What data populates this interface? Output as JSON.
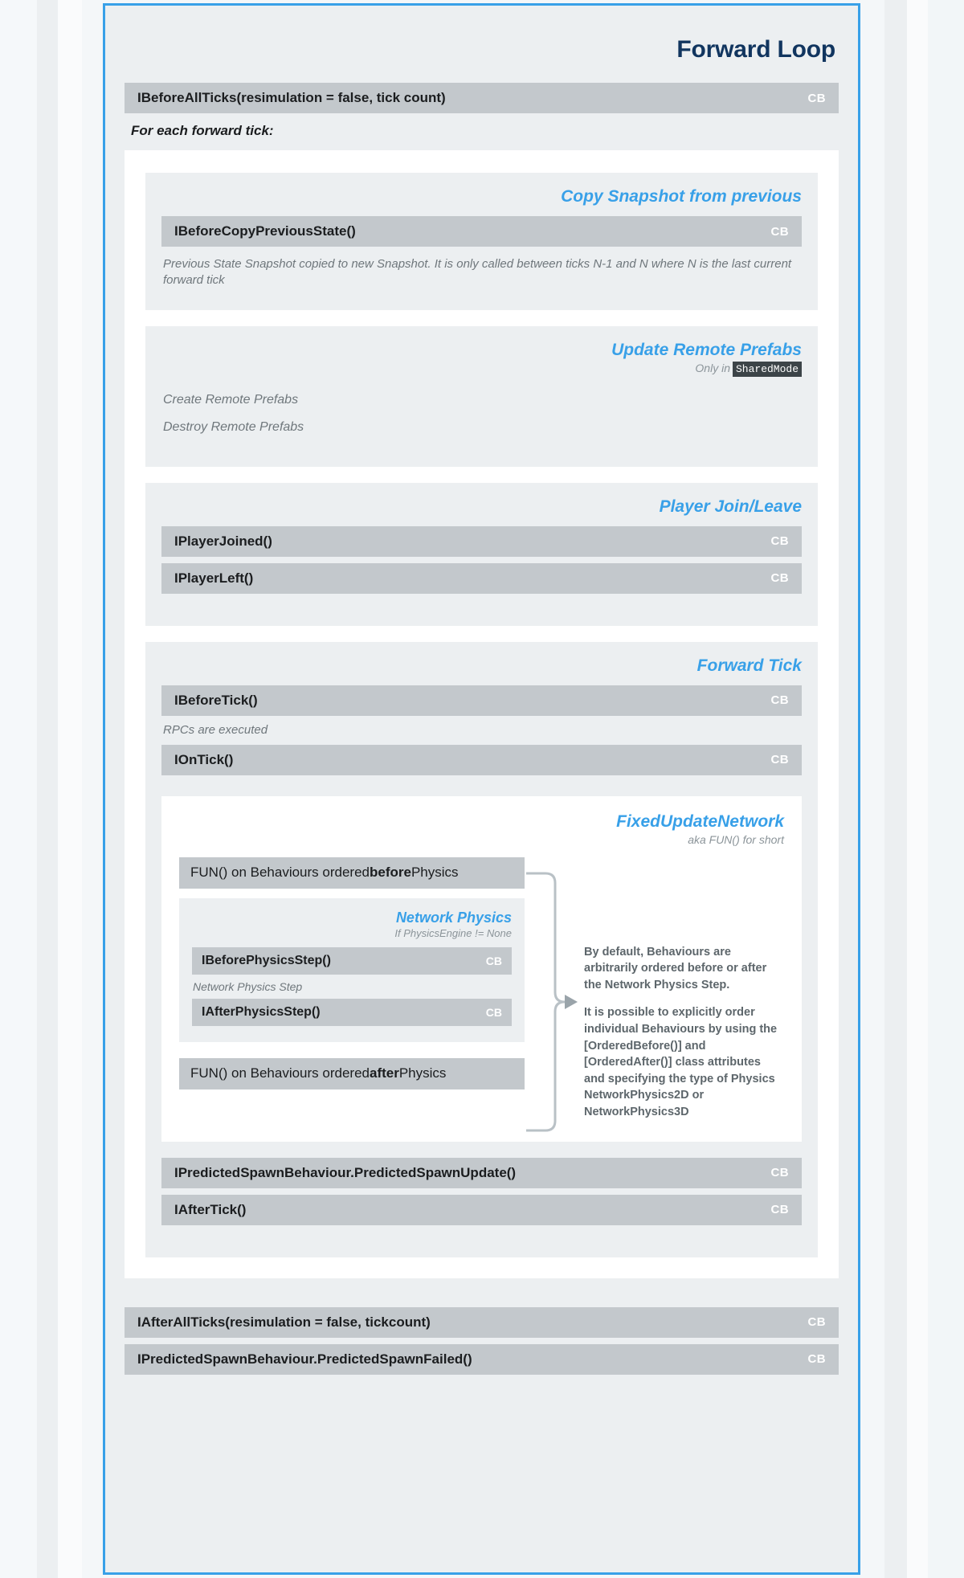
{
  "panel": {
    "title": "Forward Loop",
    "accent_color": "#38a0e8",
    "title_color": "#11355f",
    "bar_color": "#c3c8cc",
    "card_color": "#eceff1"
  },
  "top_callback": {
    "label": "IBeforeAllTicks(resimulation = false, tick count)",
    "badge": "CB"
  },
  "foreach_note": "For each forward tick:",
  "sections": {
    "copy_snapshot": {
      "title": "Copy Snapshot from previous",
      "callback": {
        "label": "IBeforeCopyPreviousState()",
        "badge": "CB"
      },
      "note": "Previous State Snapshot copied to new Snapshot. It is only called between ticks N-1 and N where N is the last current forward tick"
    },
    "update_remote_prefabs": {
      "title": "Update Remote Prefabs",
      "sub_prefix": "Only in",
      "sub_chip": "SharedMode",
      "lines": [
        "Create Remote Prefabs",
        "Destroy Remote Prefabs"
      ]
    },
    "player_join_leave": {
      "title": "Player Join/Leave",
      "callbacks": [
        {
          "label": "IPlayerJoined()",
          "badge": "CB"
        },
        {
          "label": "IPlayerLeft()",
          "badge": "CB"
        }
      ]
    },
    "forward_tick": {
      "title": "Forward Tick",
      "before_tick": {
        "label": "IBeforeTick()",
        "badge": "CB"
      },
      "rpc_note": "RPCs are executed",
      "on_tick": {
        "label": "IOnTick()",
        "badge": "CB"
      },
      "fun": {
        "title": "FixedUpdateNetwork",
        "sub": "aka FUN() for short",
        "before_bar": {
          "prefix": "FUN() on Behaviours ordered ",
          "emphasis": "before",
          "suffix": " Physics"
        },
        "after_bar": {
          "prefix": "FUN() on Behaviours ordered ",
          "emphasis": "after",
          "suffix": " Physics"
        },
        "network_physics": {
          "title": "Network Physics",
          "sub": "If PhysicsEngine != None",
          "before_step": {
            "label": "IBeforePhysicsStep()",
            "badge": "CB"
          },
          "mid_note": "Network Physics Step",
          "after_step": {
            "label": "IAfterPhysicsStep()",
            "badge": "CB"
          }
        },
        "side_note_1": "By default, Behaviours are arbitrarily ordered before or after the Network Physics Step.",
        "side_note_2": "It is possible to explicitly order individual Behaviours by using the [OrderedBefore()] and [OrderedAfter()] class attributes and specifying the type of Physics NetworkPhysics2D or NetworkPhysics3D"
      },
      "predicted_spawn_update": {
        "label": "IPredictedSpawnBehaviour.PredictedSpawnUpdate()",
        "badge": "CB"
      },
      "after_tick": {
        "label": "IAfterTick()",
        "badge": "CB"
      }
    }
  },
  "bottom_callbacks": [
    {
      "label": "IAfterAllTicks(resimulation = false, tickcount)",
      "badge": "CB"
    },
    {
      "label": "IPredictedSpawnBehaviour.PredictedSpawnFailed()",
      "badge": "CB"
    }
  ]
}
